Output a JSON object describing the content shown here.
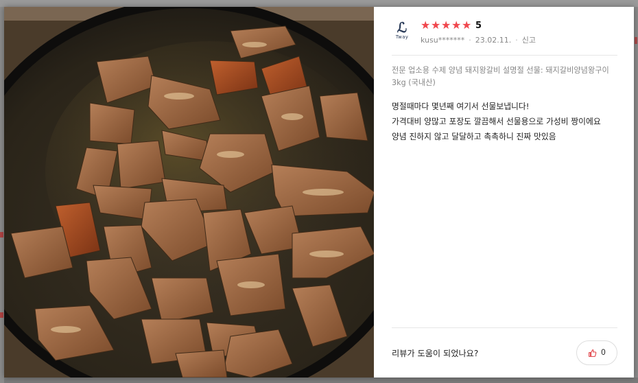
{
  "review": {
    "logo_text": "Tway",
    "rating": "5",
    "stars_filled": 5,
    "star_color": "#f0474d",
    "username": "kusu*******",
    "date": "23.02.11.",
    "report_label": "신고",
    "product_name": "전문 업소용 수제 양념 돼지왕갈비 설명절 선물: 돼지갈비양념왕구이 3kg (국내산)",
    "lines": [
      "명절때마다 몇년째 여기서 선물보냅니다!",
      "가격대비 양많고 포장도 깔끔해서 선물용으로 가성비 짱이에요",
      "양념 진하지 않고 달달하고 촉촉하니 진짜 맛있음"
    ],
    "helpful_question": "리뷰가 도움이 되었나요?",
    "like_count": "0",
    "like_icon_color": "#e0383e"
  }
}
